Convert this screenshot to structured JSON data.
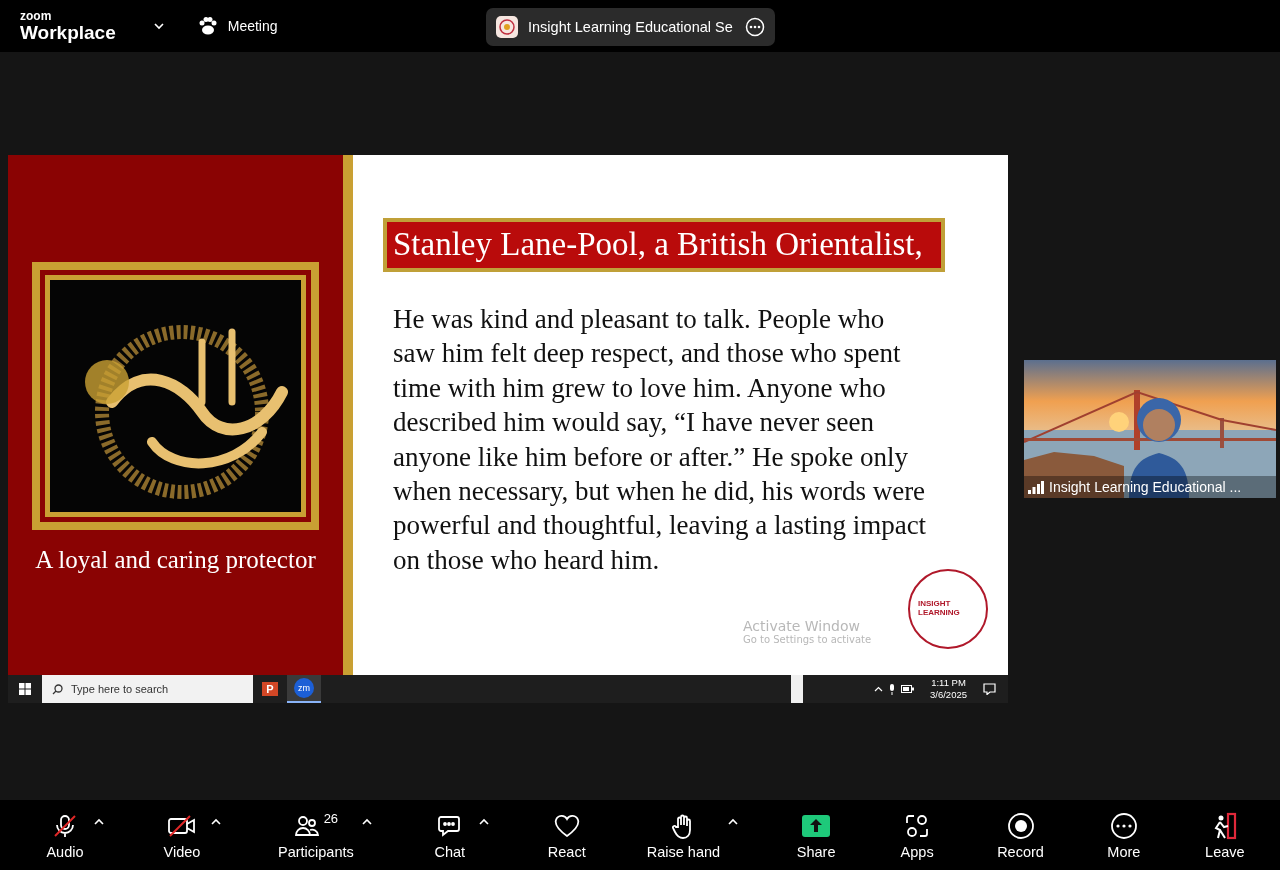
{
  "top_bar": {
    "brand_small": "zoom",
    "brand_large": "Workplace",
    "meeting_label": "Meeting",
    "share_title": "Insight Learning Educational Se"
  },
  "slide": {
    "caption": "A loyal and caring protector",
    "heading": "Stanley Lane-Pool, a British Orientalist,",
    "body": "He was kind and pleasant to talk. People who saw him felt deep respect, and those who spent time with him grew to love him. Anyone who described him would say, “I have never seen anyone like him before or after.” He spoke only when necessary, but when he did, his words were powerful and thoughtful, leaving a lasting impact on those who heard him.",
    "logo_lines": [
      "INSIGHT",
      "LEARNING"
    ],
    "activation": {
      "title": "Activate Window",
      "subtitle": "Go to Settings to activate"
    },
    "taskbar": {
      "search_placeholder": "Type here to search",
      "apps": [
        {
          "kind": "powerpoint",
          "label": "P",
          "selected": false
        },
        {
          "kind": "zoom",
          "label": "zm",
          "selected": true
        }
      ],
      "time": "1:11 PM",
      "date": "3/6/2025"
    }
  },
  "video_tile": {
    "kind": "picture",
    "name": "Insight Learning Educational ..."
  },
  "toolbar": [
    {
      "kind": "audio",
      "label": "Audio",
      "muted": true,
      "caret": true
    },
    {
      "kind": "video",
      "label": "Video",
      "muted": true,
      "caret": true
    },
    {
      "kind": "participants",
      "label": "Participants",
      "count": "26",
      "caret": true
    },
    {
      "kind": "chat",
      "label": "Chat",
      "caret": true
    },
    {
      "kind": "react",
      "label": "React",
      "caret": false
    },
    {
      "kind": "hand",
      "label": "Raise hand",
      "caret": true
    },
    {
      "kind": "share",
      "label": "Share",
      "caret": false
    },
    {
      "kind": "apps",
      "label": "Apps",
      "caret": false
    },
    {
      "kind": "record",
      "label": "Record",
      "caret": false
    },
    {
      "kind": "more",
      "label": "More",
      "caret": false
    },
    {
      "kind": "leave",
      "label": "Leave",
      "caret": false
    }
  ]
}
